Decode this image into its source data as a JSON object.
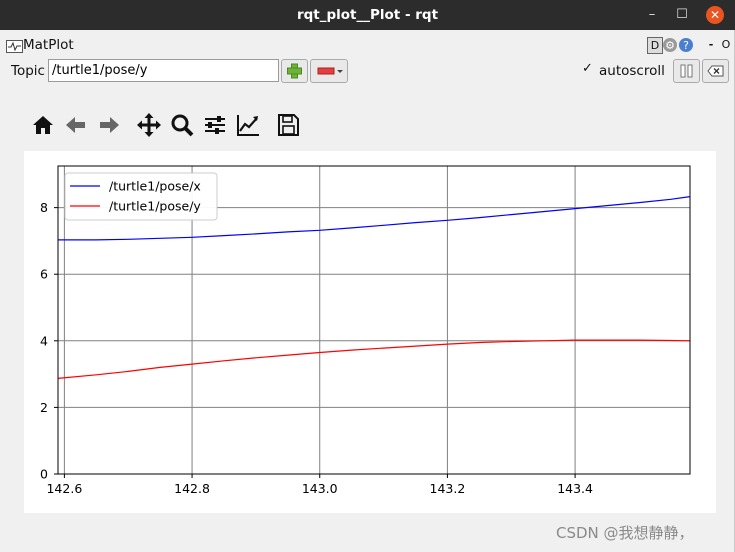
{
  "window": {
    "title": "rqt_plot__Plot - rqt",
    "min_glyph": "–",
    "max_glyph": "☐",
    "close_glyph": "✕"
  },
  "plugin": {
    "name": "MatPlot",
    "d_label": "D",
    "help_label": "?",
    "dash_label": "-",
    "o_label": "O"
  },
  "topic": {
    "label": "Topic",
    "value": "/turtle1/pose/y"
  },
  "autoscroll": {
    "label": "autoscroll",
    "checked": true
  },
  "toolbar": {
    "items": [
      "home-icon",
      "back-arrow-icon",
      "forward-arrow-icon",
      "pan-icon",
      "zoom-icon",
      "configure-subplots-icon",
      "edit-axis-icon",
      "save-icon"
    ]
  },
  "colors": {
    "x_series": "#0000ff",
    "y_series": "#ff0000",
    "close_button": "#e95420",
    "add_icon": "#6fb23a"
  },
  "chart_data": {
    "type": "line",
    "title": "",
    "xlabel": "",
    "ylabel": "",
    "xlim": [
      142.59,
      143.58
    ],
    "ylim": [
      0,
      9.25
    ],
    "xticks": [
      142.6,
      142.8,
      143.0,
      143.2,
      143.4
    ],
    "xtick_labels": [
      "142.6",
      "142.8",
      "143.0",
      "143.2",
      "143.4"
    ],
    "yticks": [
      0,
      2,
      4,
      6,
      8
    ],
    "ytick_labels": [
      "0",
      "2",
      "4",
      "6",
      "8"
    ],
    "grid": true,
    "legend": "top-left",
    "series": [
      {
        "name": "/turtle1/pose/x",
        "color": "#0000ff",
        "x": [
          142.59,
          142.65,
          142.7,
          142.75,
          142.8,
          142.85,
          142.9,
          142.95,
          143.0,
          143.05,
          143.1,
          143.15,
          143.2,
          143.25,
          143.3,
          143.35,
          143.4,
          143.45,
          143.5,
          143.55,
          143.58
        ],
        "y": [
          7.03,
          7.03,
          7.05,
          7.08,
          7.11,
          7.16,
          7.21,
          7.27,
          7.32,
          7.39,
          7.47,
          7.55,
          7.62,
          7.7,
          7.79,
          7.88,
          7.97,
          8.06,
          8.15,
          8.25,
          8.33
        ]
      },
      {
        "name": "/turtle1/pose/y",
        "color": "#ff0000",
        "x": [
          142.59,
          142.65,
          142.7,
          142.75,
          142.8,
          142.85,
          142.9,
          142.95,
          143.0,
          143.05,
          143.1,
          143.15,
          143.2,
          143.25,
          143.3,
          143.35,
          143.4,
          143.45,
          143.5,
          143.55,
          143.58
        ],
        "y": [
          2.87,
          2.98,
          3.08,
          3.2,
          3.3,
          3.4,
          3.49,
          3.57,
          3.65,
          3.72,
          3.78,
          3.84,
          3.9,
          3.95,
          3.98,
          4.0,
          4.02,
          4.02,
          4.02,
          4.01,
          4.0
        ]
      }
    ]
  },
  "watermark": "CSDN @我想静静，"
}
